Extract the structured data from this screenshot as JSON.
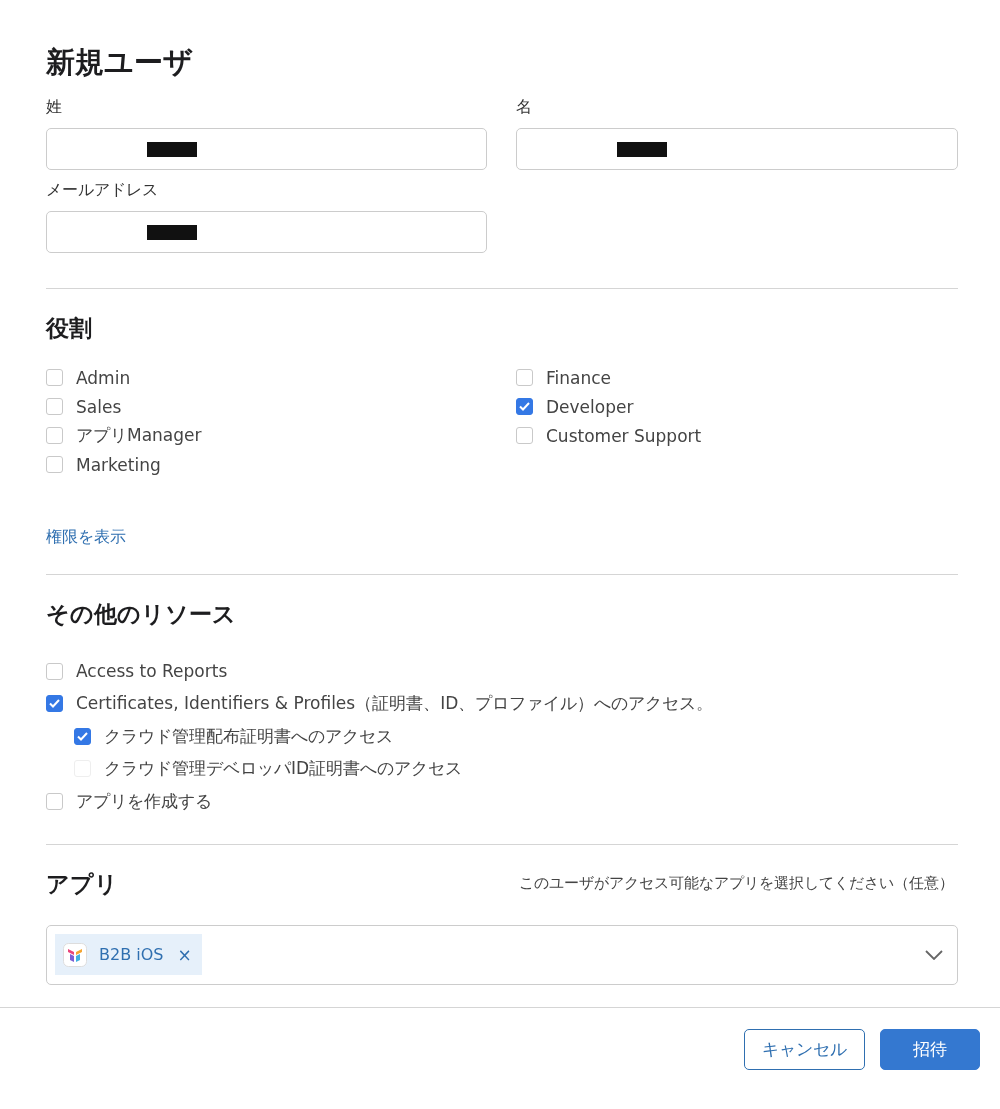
{
  "title": "新規ユーザ",
  "fields": [
    {
      "label": "姓",
      "redacted": true
    },
    {
      "label": "名",
      "redacted": true
    },
    {
      "label": "メールアドレス",
      "redacted": true
    }
  ],
  "roles": {
    "heading": "役割",
    "columns": [
      [
        {
          "label": "Admin",
          "checked": false
        },
        {
          "label": "Sales",
          "checked": false
        },
        {
          "label": "アプリManager",
          "checked": false
        },
        {
          "label": "Marketing",
          "checked": false
        }
      ],
      [
        {
          "label": "Finance",
          "checked": false
        },
        {
          "label": "Developer",
          "checked": true
        },
        {
          "label": "Customer Support",
          "checked": false
        }
      ]
    ],
    "link": "権限を表示"
  },
  "resources": {
    "heading": "その他のリソース",
    "items": [
      {
        "label": "Access to Reports",
        "checked": false,
        "disabled": false
      },
      {
        "label": "Certificates, Identifiers & Profiles（証明書、ID、プロファイル）へのアクセス。",
        "checked": true,
        "disabled": false,
        "children": [
          {
            "label": "クラウド管理配布証明書へのアクセス",
            "checked": true,
            "disabled": false
          },
          {
            "label": "クラウド管理デベロッパID証明書へのアクセス",
            "checked": false,
            "disabled": true
          }
        ]
      },
      {
        "label": "アプリを作成する",
        "checked": false,
        "disabled": false
      }
    ]
  },
  "apps": {
    "heading": "アプリ",
    "hint": "このユーザがアクセス可能なアプリを選択してください（任意）",
    "chips": [
      {
        "label": "B2B iOS",
        "remove": "×"
      }
    ]
  },
  "buttons": [
    {
      "label": "キャンセル",
      "kind": "secondary"
    },
    {
      "label": "招待",
      "kind": "primary"
    }
  ]
}
